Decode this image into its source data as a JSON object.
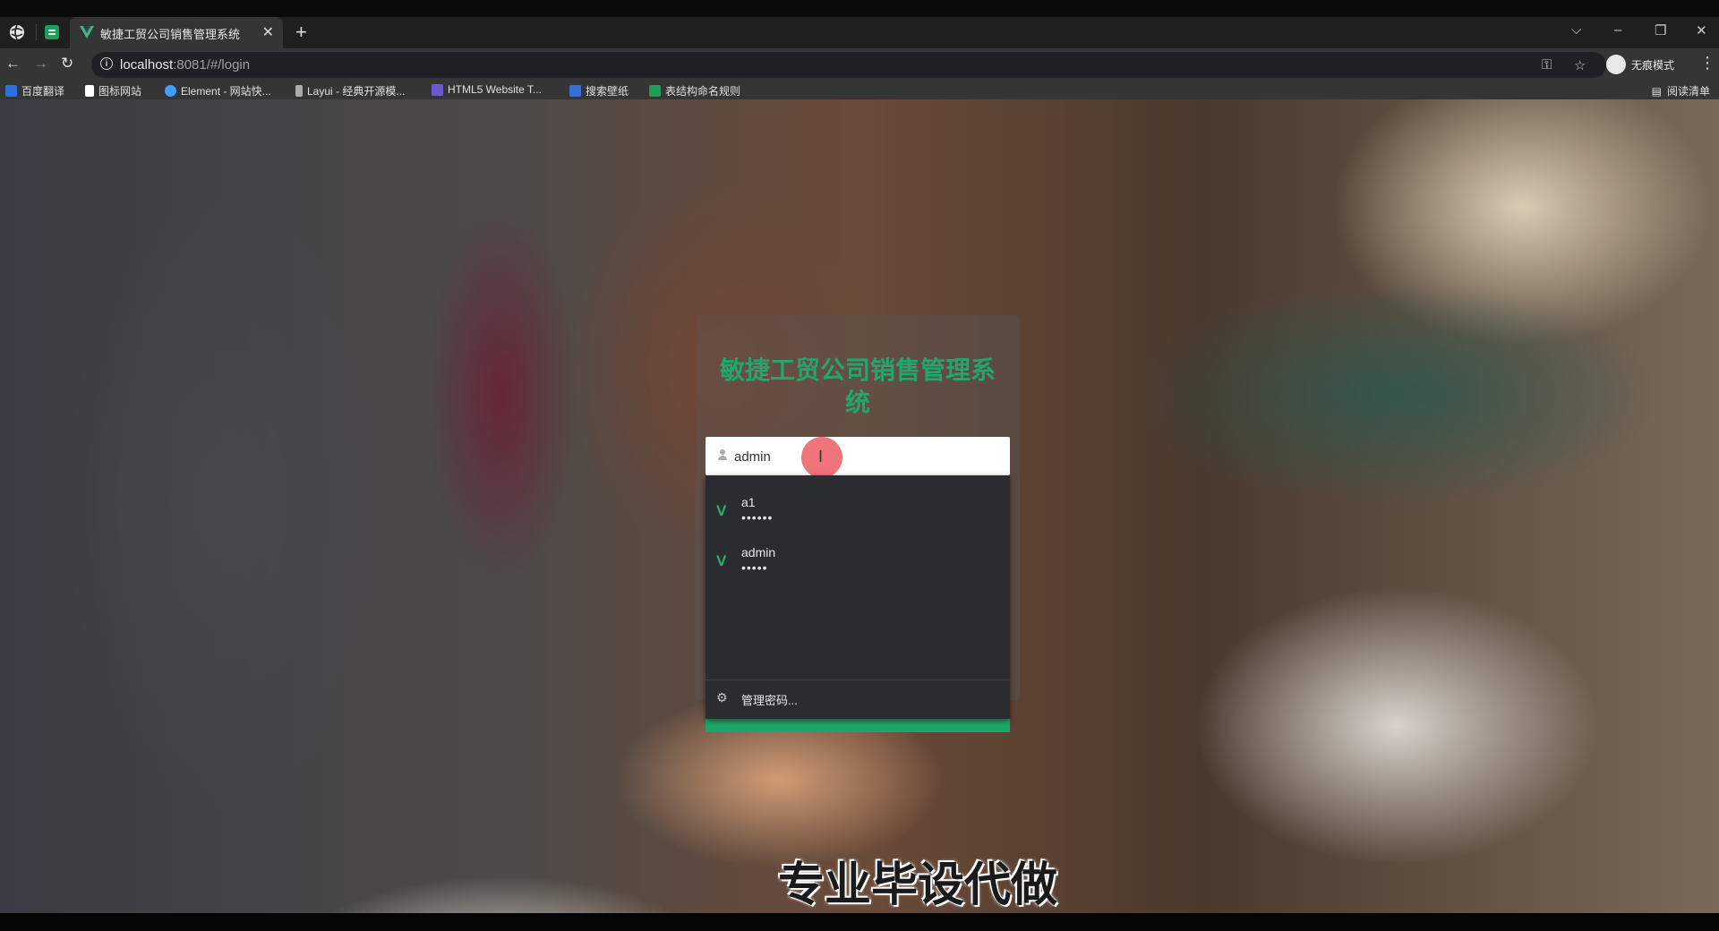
{
  "browser": {
    "tabs": [
      {
        "title": "",
        "icon": "sheet-icon"
      },
      {
        "title": "敏捷工贸公司销售管理系统",
        "icon": "vue-logo-icon",
        "active": true
      }
    ],
    "new_tab": "+",
    "close_tab": "✕",
    "url_host": "localhost",
    "url_path": ":8081/#/login",
    "incognito_label": "无痕模式",
    "bookmarks": [
      {
        "label": "百度翻译",
        "color": "#2f6fe0"
      },
      {
        "label": "图标网站",
        "color": "#ffffff"
      },
      {
        "label": "Element - 网站快...",
        "color": "#409eff"
      },
      {
        "label": "Layui - 经典开源模...",
        "color": "#aaaaaa"
      },
      {
        "label": "HTML5 Website T...",
        "color": "#6a5acd"
      },
      {
        "label": "搜索壁纸",
        "color": "#3b6fd8"
      },
      {
        "label": "表结构命名规则",
        "color": "#19a05a"
      }
    ],
    "reading_list": "阅读清单"
  },
  "login": {
    "title": "敏捷工贸公司销售管理系统",
    "username_value": "admin",
    "accent": "#21a66b"
  },
  "autofill": {
    "items": [
      {
        "user": "a1",
        "password_mask": "••••••"
      },
      {
        "user": "admin",
        "password_mask": "•••••"
      }
    ],
    "manage_label": "管理密码..."
  },
  "watermark": "专业毕设代做"
}
